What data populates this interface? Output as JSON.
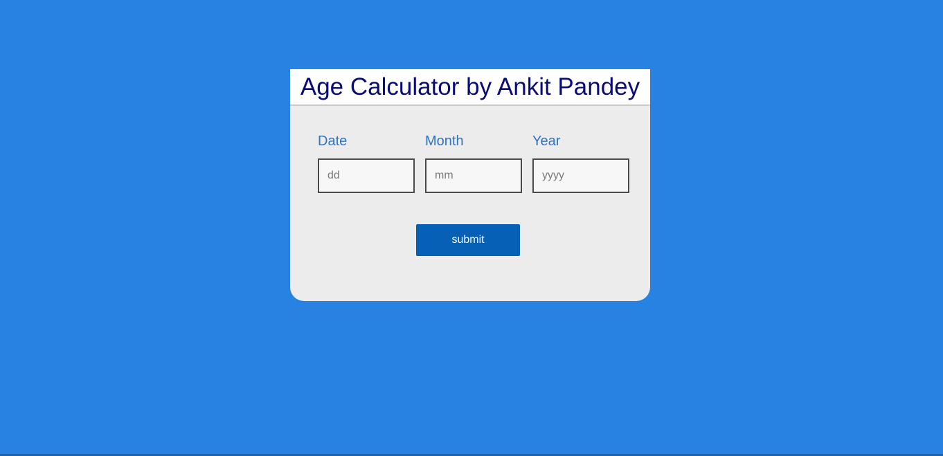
{
  "page": {
    "background_color": "#2882e2"
  },
  "card": {
    "title": "Age Calculator by Ankit Pandey",
    "title_color": "#0b0b78",
    "fields": [
      {
        "label": "Date",
        "placeholder": "dd",
        "value": ""
      },
      {
        "label": "Month",
        "placeholder": "mm",
        "value": ""
      },
      {
        "label": "Year",
        "placeholder": "yyyy",
        "value": ""
      }
    ],
    "submit_label": "submit",
    "submit_color": "#0660b6"
  }
}
